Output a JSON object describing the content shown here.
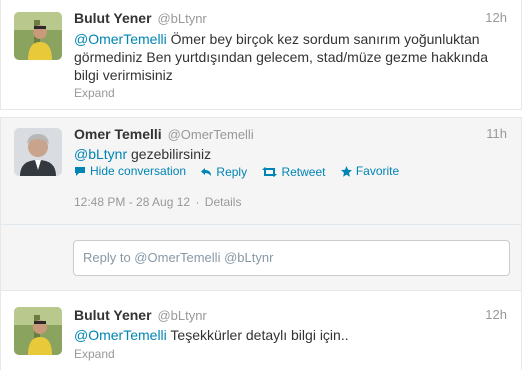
{
  "tweets": [
    {
      "fullname": "Bulut Yener",
      "username": "@bLtynr",
      "time": "12h",
      "mention": "@OmerTemelli",
      "text": " Ömer bey birçok kez sordum sanırım yoğunluktan görmediniz Ben yurtdışından gelecem, stad/müze gezme hakkında bilgi verirmisiniz",
      "expand": "Expand"
    },
    {
      "fullname": "Omer Temelli",
      "username": "@OmerTemelli",
      "time": "11h",
      "mention": "@bLtynr",
      "text": " gezebilirsiniz",
      "actions": {
        "hide": "Hide conversation",
        "reply": "Reply",
        "retweet": "Retweet",
        "favorite": "Favorite"
      },
      "timestamp": "12:48 PM - 28 Aug 12",
      "separator": "·",
      "details": "Details",
      "reply_placeholder": "Reply to @OmerTemelli @bLtynr"
    },
    {
      "fullname": "Bulut Yener",
      "username": "@bLtynr",
      "time": "12h",
      "mention": "@OmerTemelli",
      "text": " Teşekkürler detaylı bilgi için..",
      "expand": "Expand"
    }
  ],
  "colors": {
    "link": "#0084b4",
    "muted": "#999999",
    "text": "#333333",
    "expanded_bg": "#f5f5f5"
  }
}
